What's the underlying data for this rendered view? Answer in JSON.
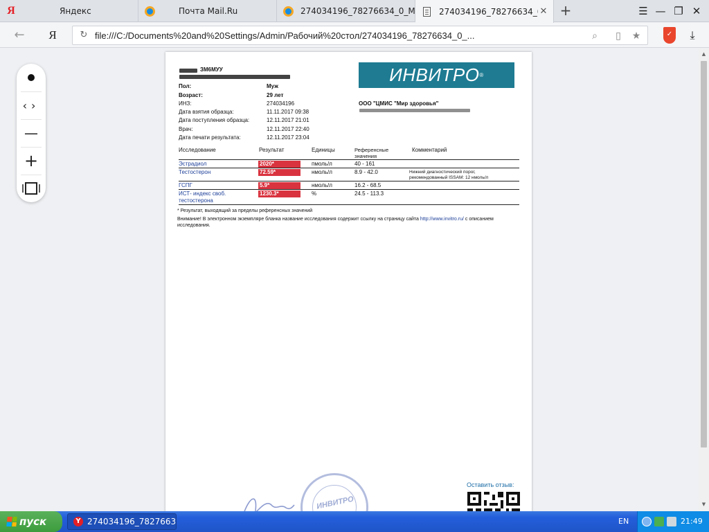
{
  "tabs": [
    {
      "label": "Яндекс",
      "icon": "yandex-logo-icon"
    },
    {
      "label": "Почта Mail.Ru",
      "icon": "mail-ru-icon"
    },
    {
      "label": "274034196_78276634_0_ME",
      "icon": "mail-ru-icon"
    },
    {
      "label": "274034196_78276634_0_",
      "icon": "document-icon",
      "active": true
    }
  ],
  "toolbar": {
    "url": "file:///C:/Documents%20and%20Settings/Admin/Рабочий%20стол/274034196_78276634_0_..."
  },
  "viewer_tools": [
    "pointer-dot-icon",
    "page-nav-icon",
    "zoom-out-icon",
    "zoom-in-icon",
    "fit-page-icon"
  ],
  "document": {
    "patient_name_partial": "ЗМ6МУУ",
    "gender_label": "Пол:",
    "gender_value": "Муж",
    "age_label": "Возраст:",
    "age_value": "29 лет",
    "inz_label": "ИНЗ:",
    "inz_value": "274034196",
    "sample_date_label": "Дата взятия образца:",
    "sample_date_value": "11.11.2017 09:38",
    "received_label": "Дата поступления образца:",
    "received_value": "12.11.2017 21:01",
    "doctor_label": "Врач:",
    "doctor_value": "12.11.2017 22:40",
    "print_label": "Дата печати результата:",
    "print_value": "12.11.2017 23:04",
    "logo_text": "ИНВИТРО",
    "org_name": "ООО \"ЦМИС \"Мир здоровья\"",
    "columns": {
      "test": "Исследование",
      "result": "Результат",
      "units": "Единицы",
      "reference": "Референсные значения",
      "comment": "Комментарий"
    },
    "rows": [
      {
        "test": "Эстрадиол",
        "result": "2020*",
        "units": "пмоль/л",
        "reference": "40 - 161",
        "comment": ""
      },
      {
        "test": "Тестостерон",
        "result": "72.59*",
        "units": "нмоль/л",
        "reference": "8.9 - 42.0",
        "comment": "Нижний диагностический порог, рекомендованный ISSAM: 12 нмоль/л"
      },
      {
        "test": "ГСПГ",
        "result": "5.9*",
        "units": "нмоль/л",
        "reference": "16.2 - 68.5",
        "comment": ""
      },
      {
        "test": "ИСТ- индекс своб. тестостерона",
        "result": "1230.3*",
        "units": "%",
        "reference": "24.5 - 113.3",
        "comment": ""
      }
    ],
    "footnote": "* Результат, выходящий за пределы референсных значений",
    "notice_prefix": "Внимание! В электронном экземпляре бланка название исследования содержит ссылку на страницу сайта",
    "notice_link": "http://www.invitro.ru/",
    "notice_suffix": "с описанием исследования.",
    "feedback": "Оставить отзыв:",
    "stamp_text": "ИНВИТРО"
  },
  "taskbar": {
    "start_label": "пуск",
    "window_label": "274034196_7827663...",
    "language": "EN",
    "clock": "21:49"
  },
  "colors": {
    "invitro_teal": "#1e7b92",
    "flag_red": "#d9333f",
    "link_blue": "#1d3f99"
  }
}
